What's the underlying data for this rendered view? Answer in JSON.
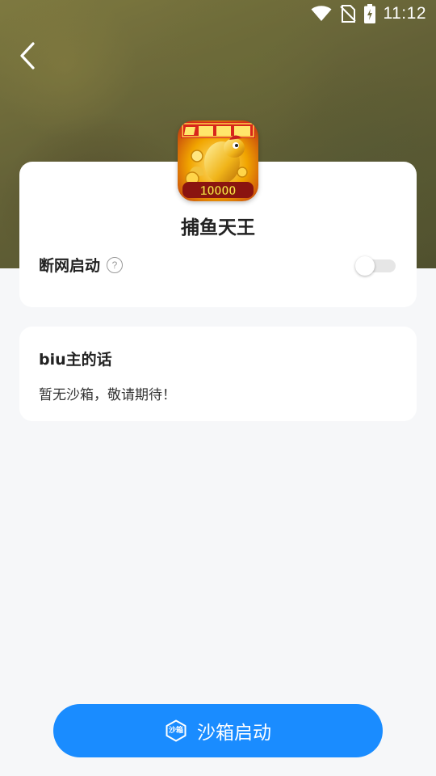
{
  "status_bar": {
    "time": "11:12",
    "icons": [
      "wifi-icon",
      "no-sim-icon",
      "battery-charging-icon"
    ]
  },
  "header": {
    "back_icon": "chevron-left-icon"
  },
  "app": {
    "name": "捕鱼天王",
    "icon_text": "10000",
    "offline_launch_label": "断网启动",
    "offline_launch_enabled": false,
    "help_icon": "question-circle-icon"
  },
  "note": {
    "title": "biu主的话",
    "text": "暂无沙箱，敬请期待！"
  },
  "launch_button": {
    "badge_text": "沙箱",
    "label": "沙箱启动"
  },
  "colors": {
    "accent": "#1a8cff",
    "background": "#f6f7f9",
    "card": "#ffffff"
  }
}
